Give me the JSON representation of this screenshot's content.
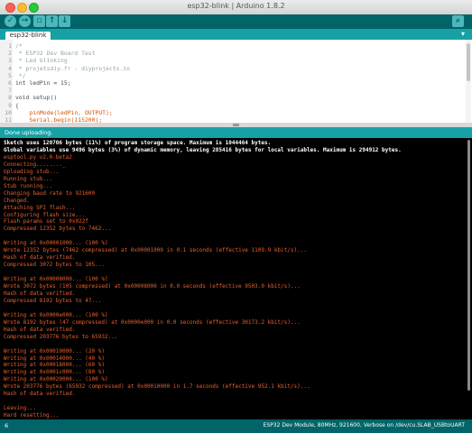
{
  "window": {
    "title": "esp32-blink | Arduino 1.8.2"
  },
  "toolbar": {
    "buttons": [
      {
        "name": "verify",
        "icon": "check-icon",
        "glyph": "✓"
      },
      {
        "name": "upload",
        "icon": "arrow-right-icon",
        "glyph": "→"
      },
      {
        "name": "new",
        "icon": "new-file-icon",
        "glyph": "▫"
      },
      {
        "name": "open",
        "icon": "arrow-up-icon",
        "glyph": "↑"
      },
      {
        "name": "save",
        "icon": "arrow-down-icon",
        "glyph": "↓"
      }
    ],
    "serial_monitor": {
      "icon": "magnifier-icon",
      "glyph": "⌕"
    }
  },
  "tabs": {
    "items": [
      "esp32-blink"
    ],
    "menu_glyph": "▾"
  },
  "editor": {
    "lines": [
      {
        "num": "1",
        "text": "/*",
        "cls": "cmt"
      },
      {
        "num": "2",
        "text": " * ESP32 Dev Board Test",
        "cls": "cmt"
      },
      {
        "num": "3",
        "text": " * Led blinking",
        "cls": "cmt"
      },
      {
        "num": "4",
        "text": " * projetsdiy.fr - diyprojects.io",
        "cls": "cmt"
      },
      {
        "num": "5",
        "text": " */",
        "cls": "cmt"
      },
      {
        "num": "6",
        "text": "int ledPin = 15;",
        "cls": "txt"
      },
      {
        "num": "7",
        "text": "",
        "cls": "txt"
      },
      {
        "num": "8",
        "text": "void setup()",
        "cls": "txt"
      },
      {
        "num": "9",
        "text": "{",
        "cls": "txt"
      },
      {
        "num": "10",
        "text": "    pinMode(ledPin, OUTPUT);",
        "cls": "fn"
      },
      {
        "num": "11",
        "text": "    Serial.begin(115200);",
        "cls": "fn"
      }
    ]
  },
  "status": {
    "text": "Done uploading."
  },
  "console": {
    "lines": [
      {
        "text": "Sketch uses 120706 bytes (11%) of program storage space. Maximum is 1044464 bytes.",
        "cls": "white"
      },
      {
        "text": "Global variables use 9496 bytes (3%) of dynamic memory, leaving 285416 bytes for local variables. Maximum is 294912 bytes.",
        "cls": "white"
      },
      {
        "text": "esptool.py v2.0-beta2",
        "cls": "orange"
      },
      {
        "text": "Connecting........_",
        "cls": "orange"
      },
      {
        "text": "Uploading stub...",
        "cls": "orange"
      },
      {
        "text": "Running stub...",
        "cls": "orange"
      },
      {
        "text": "Stub running...",
        "cls": "orange"
      },
      {
        "text": "Changing baud rate to 921600",
        "cls": "orange"
      },
      {
        "text": "Changed.",
        "cls": "orange"
      },
      {
        "text": "Attaching SPI flash...",
        "cls": "orange"
      },
      {
        "text": "Configuring flash size...",
        "cls": "orange"
      },
      {
        "text": "Flash params set to 0x022f",
        "cls": "orange"
      },
      {
        "text": "Compressed 12352 bytes to 7462...",
        "cls": "orange"
      },
      {
        "text": "",
        "cls": "orange"
      },
      {
        "text": "Writing at 0x00001000... (100 %)",
        "cls": "orange"
      },
      {
        "text": "Wrote 12352 bytes (7462 compressed) at 0x00001000 in 0.1 seconds (effective 1109.9 kbit/s)...",
        "cls": "orange"
      },
      {
        "text": "Hash of data verified.",
        "cls": "orange"
      },
      {
        "text": "Compressed 3072 bytes to 105...",
        "cls": "orange"
      },
      {
        "text": "",
        "cls": "orange"
      },
      {
        "text": "Writing at 0x00008000... (100 %)",
        "cls": "orange"
      },
      {
        "text": "Wrote 3072 bytes (105 compressed) at 0x00008000 in 0.0 seconds (effective 9503.0 kbit/s)...",
        "cls": "orange"
      },
      {
        "text": "Hash of data verified.",
        "cls": "orange"
      },
      {
        "text": "Compressed 8192 bytes to 47...",
        "cls": "orange"
      },
      {
        "text": "",
        "cls": "orange"
      },
      {
        "text": "Writing at 0x0000e000... (100 %)",
        "cls": "orange"
      },
      {
        "text": "Wrote 8192 bytes (47 compressed) at 0x0000e000 in 0.0 seconds (effective 30173.2 kbit/s)...",
        "cls": "orange"
      },
      {
        "text": "Hash of data verified.",
        "cls": "orange"
      },
      {
        "text": "Compressed 203776 bytes to 65932...",
        "cls": "orange"
      },
      {
        "text": "",
        "cls": "orange"
      },
      {
        "text": "Writing at 0x00010000... (20 %)",
        "cls": "orange"
      },
      {
        "text": "Writing at 0x00014000... (40 %)",
        "cls": "orange"
      },
      {
        "text": "Writing at 0x00018000... (60 %)",
        "cls": "orange"
      },
      {
        "text": "Writing at 0x0001c000... (80 %)",
        "cls": "orange"
      },
      {
        "text": "Writing at 0x00020000... (100 %)",
        "cls": "orange"
      },
      {
        "text": "Wrote 203776 bytes (65932 compressed) at 0x00010000 in 1.7 seconds (effective 952.1 kbit/s)...",
        "cls": "orange"
      },
      {
        "text": "Hash of data verified.",
        "cls": "orange"
      },
      {
        "text": "",
        "cls": "orange"
      },
      {
        "text": "Leaving...",
        "cls": "orange"
      },
      {
        "text": "Hard resetting...",
        "cls": "orange"
      }
    ]
  },
  "footer": {
    "line_number": "6",
    "board": "ESP32 Dev Module, 80MHz, 921600, Verbose on /dev/cu.SLAB_USBtoUART"
  }
}
